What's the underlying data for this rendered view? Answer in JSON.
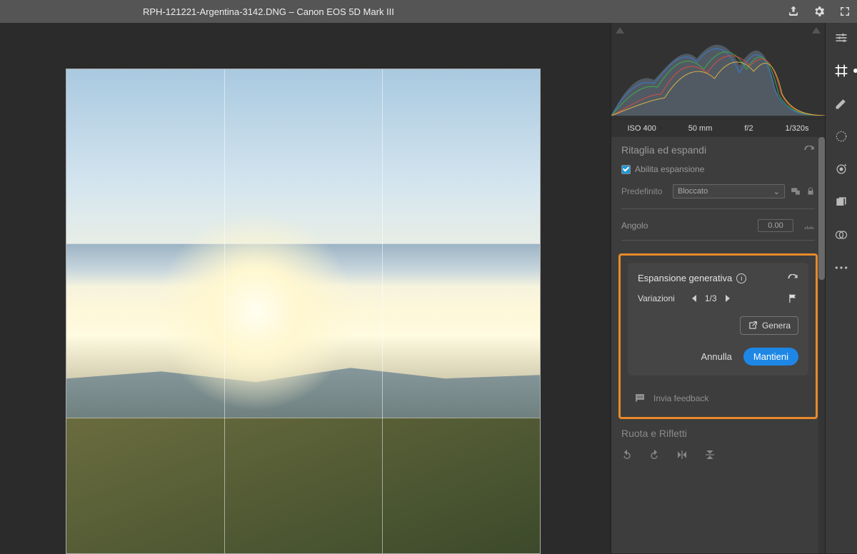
{
  "topbar": {
    "title": "RPH-121221-Argentina-3142.DNG  –  Canon EOS 5D Mark III"
  },
  "meta": {
    "iso": "ISO 400",
    "focal": "50 mm",
    "aperture": "f/2",
    "shutter": "1/320s"
  },
  "crop_panel": {
    "title": "Ritaglia ed espandi",
    "enable_label": "Abilita espansione",
    "preset_label": "Predefinito",
    "preset_value": "Bloccato",
    "angle_label": "Angolo",
    "angle_value": "0.00"
  },
  "gen_panel": {
    "title": "Espansione generativa",
    "variations_label": "Variazioni",
    "variations_value": "1/3",
    "generate_label": "Genera",
    "cancel_label": "Annulla",
    "keep_label": "Mantieni",
    "feedback_label": "Invia feedback"
  },
  "rotate_panel": {
    "title": "Ruota e Rifletti"
  }
}
